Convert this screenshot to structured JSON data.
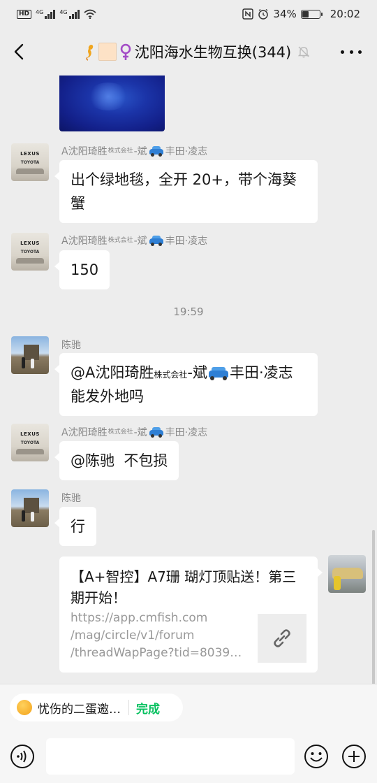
{
  "status": {
    "hd": "HD",
    "net1": "4G",
    "net2": "4G",
    "battery_pct": "34%",
    "battery_level": 0.34,
    "time": "20:02"
  },
  "nav": {
    "title": "沈阳海水生物互换(344)"
  },
  "messages": [
    {
      "sender_prefix": "A沈阳琦胜",
      "sender_kanji": "株式会社",
      "sender_suffix": "-斌",
      "sender_after": "丰田·凌志",
      "text": "出个绿地毯，全开 20+，带个海葵蟹"
    },
    {
      "sender_prefix": "A沈阳琦胜",
      "sender_kanji": "株式会社",
      "sender_suffix": "-斌",
      "sender_after": "丰田·凌志",
      "text": "150"
    },
    {
      "sender": "陈驰",
      "text_prefix": "@A沈阳琦胜",
      "text_kanji": "株式会社",
      "text_mid": "-斌",
      "text_suffix": "丰田·凌志 能发外地吗"
    },
    {
      "sender_prefix": "A沈阳琦胜",
      "sender_kanji": "株式会社",
      "sender_suffix": "-斌",
      "sender_after": "丰田·凌志",
      "text": "@陈驰  不包损"
    },
    {
      "sender": "陈驰",
      "text": "行"
    }
  ],
  "timestamp": "19:59",
  "avatar_text": {
    "lexus": "LEXUS",
    "toyota": "TOYOTA"
  },
  "link_card": {
    "title": "【A+智控】A7珊 瑚灯顶贴送！第三期开始！",
    "url_line1": "https://app.cmfish.com",
    "url_line2": "/mag/circle/v1/forum",
    "url_line3": "/threadWapPage?tid=8039…"
  },
  "quote": {
    "text": "忧伤的二蛋邀…",
    "done": "完成"
  },
  "input": {
    "value": ""
  }
}
